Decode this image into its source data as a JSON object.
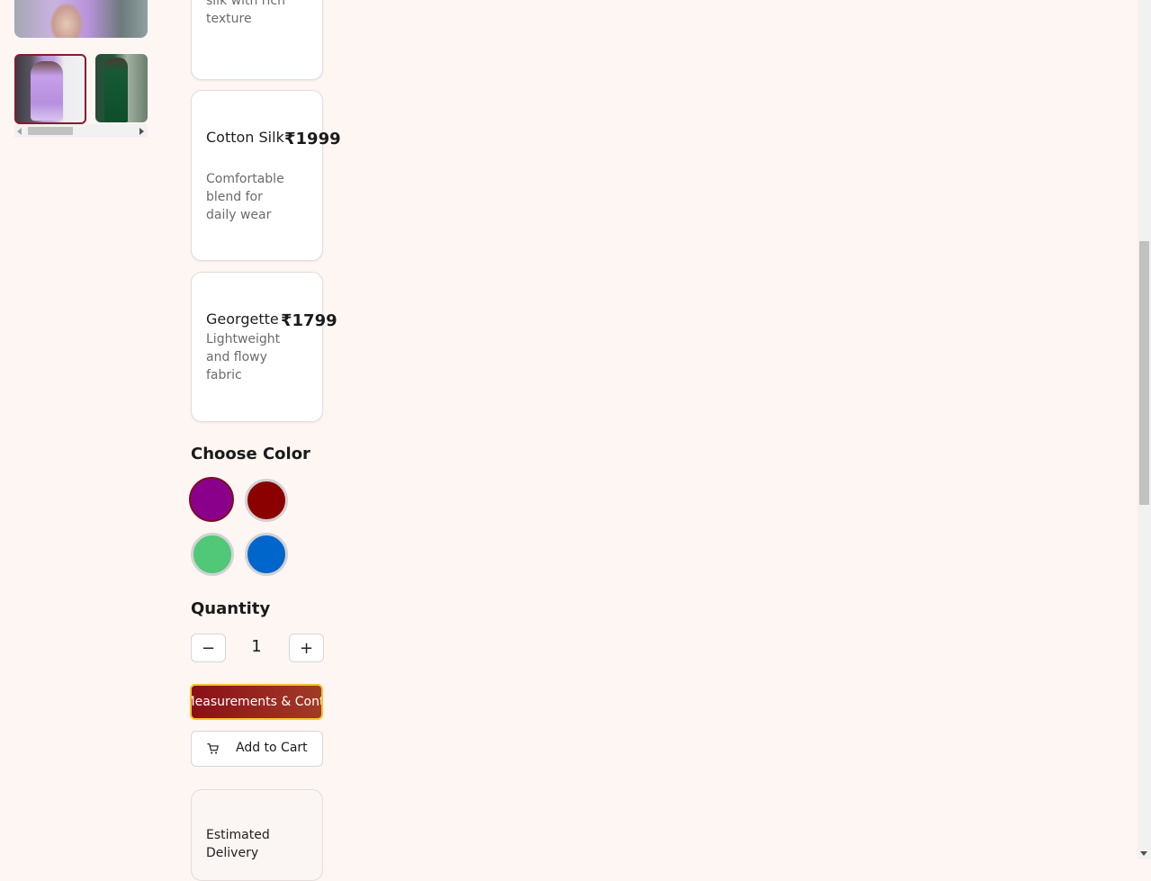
{
  "fabrics": [
    {
      "desc": "silk with rich texture"
    },
    {
      "name": "Cotton Silk",
      "price": "₹1999",
      "desc": "Comfortable blend for daily wear"
    },
    {
      "name": "Georgette",
      "price": "₹1799",
      "desc": "Lightweight and flowy fabric"
    }
  ],
  "color_section": {
    "title": "Choose Color",
    "swatches": [
      {
        "name": "purple",
        "hex": "#8b008b",
        "selected": true
      },
      {
        "name": "maroon",
        "hex": "#8b0000",
        "selected": false
      },
      {
        "name": "green",
        "hex": "#50c878",
        "selected": false
      },
      {
        "name": "blue",
        "hex": "#0066cc",
        "selected": false
      }
    ]
  },
  "quantity": {
    "title": "Quantity",
    "value": "1",
    "minus": "−",
    "plus": "+"
  },
  "actions": {
    "measurements_label": "Add Measurements & Continue",
    "add_to_cart_label": "Add to Cart"
  },
  "delivery": {
    "label": "Estimated Delivery"
  },
  "colors": {
    "background": "#fdf6f3",
    "accent": "#8b0f16",
    "focus_ring": "#f5c42c"
  }
}
